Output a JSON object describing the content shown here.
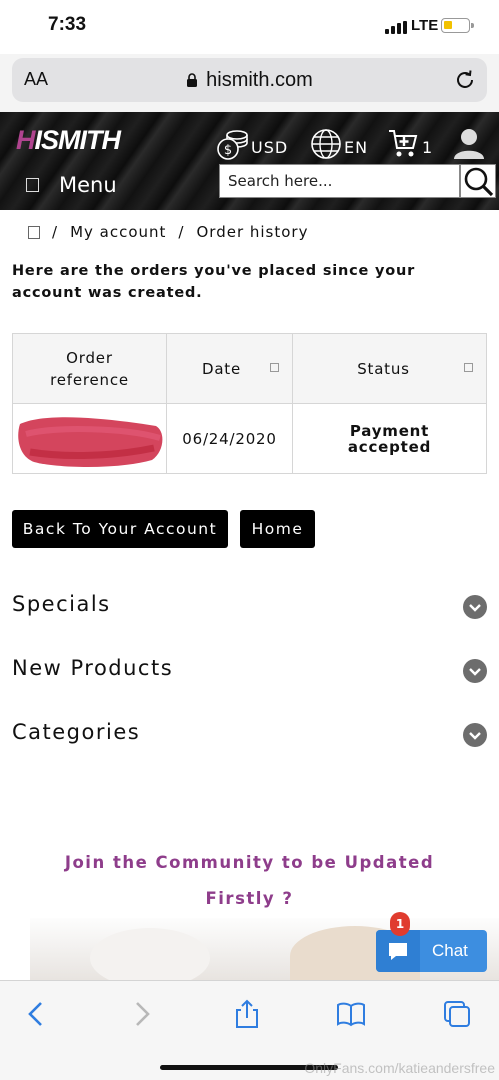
{
  "status_bar": {
    "time": "7:33",
    "network": "LTE"
  },
  "browser": {
    "text_size_label": "AA",
    "url": "hismith.com"
  },
  "header": {
    "logo": "HISMITH",
    "currency": "USD",
    "language": "EN",
    "cart_count": "1",
    "menu_label": "Menu",
    "search_placeholder": "Search here..."
  },
  "breadcrumb": {
    "sep": "/",
    "items": [
      "My account",
      "Order history"
    ]
  },
  "intro": "Here are the orders you've placed since your account was created.",
  "orders_table": {
    "columns": [
      "Order reference",
      "Date",
      "Status"
    ],
    "rows": [
      {
        "reference": "",
        "date": "06/24/2020",
        "status": "Payment accepted"
      }
    ]
  },
  "buttons": {
    "back": "Back To Your Account",
    "home": "Home"
  },
  "accordions": [
    "Specials",
    "New Products",
    "Categories"
  ],
  "community": {
    "line1": "Join the Community to be Updated",
    "line2": "Firstly ?"
  },
  "chat": {
    "label": "Chat",
    "badge": "1"
  },
  "watermark": "OnlyFans.com/katieandersfree",
  "colors": {
    "brand_purple": "#8e3d8b",
    "header_bg": "#141414",
    "chat_blue": "#3d8ee0",
    "badge_red": "#e03c2f"
  }
}
